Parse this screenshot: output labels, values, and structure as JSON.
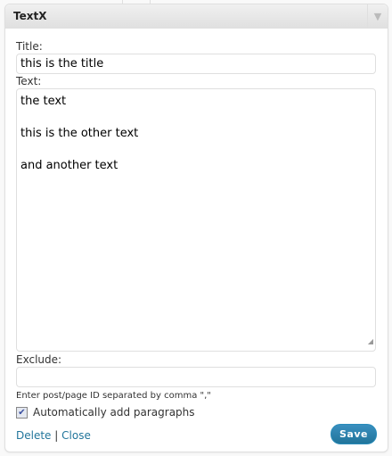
{
  "widget": {
    "title": "TextX",
    "title_label": "Title:",
    "title_value": "this is the title",
    "text_label": "Text:",
    "text_value": "the text\n\nthis is the other text\n\nand another text",
    "exclude_label": "Exclude:",
    "exclude_value": "",
    "exclude_hint": "Enter post/page ID separated by comma \",\"",
    "auto_paragraphs_label": "Automatically add paragraphs",
    "auto_paragraphs_checked": true,
    "delete_label": "Delete",
    "separator": "|",
    "close_label": "Close",
    "save_label": "Save"
  }
}
